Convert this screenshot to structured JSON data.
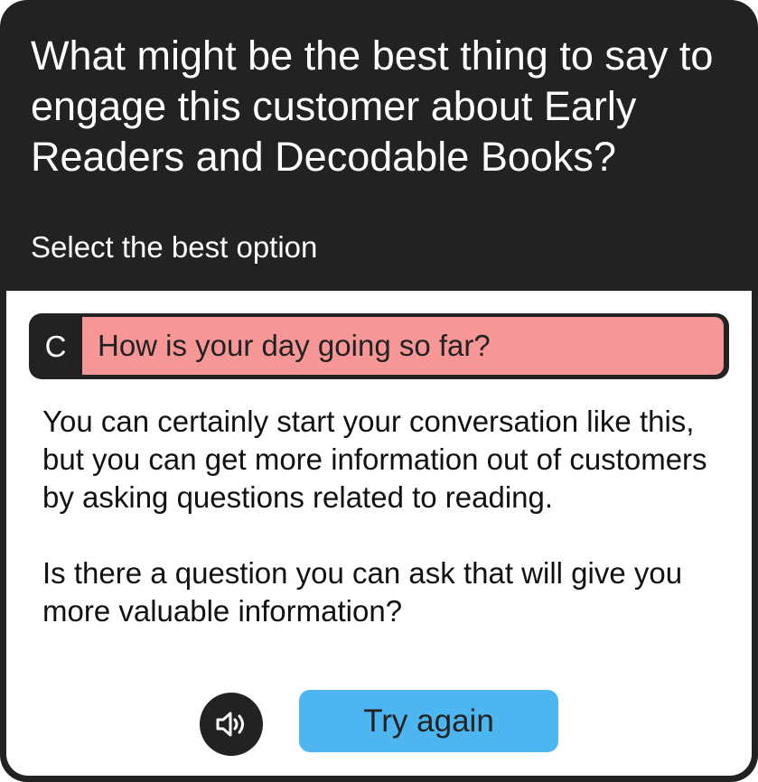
{
  "header": {
    "question": "What might be the best thing to say to engage this customer about Early Readers and Decodable Books?",
    "instruction": "Select the best option"
  },
  "selected_option": {
    "letter": "C",
    "text": "How is your day going so far?",
    "status_color": "#f79696"
  },
  "feedback": {
    "paragraph_1": "You can certainly start your conversation like this, but you can get more information out of customers by asking questions related to reading.",
    "paragraph_2": "Is there a question you can ask that will give you more valuable information?"
  },
  "actions": {
    "audio_icon": "speaker-icon",
    "try_again_label": "Try again",
    "accent_color": "#4db6f0"
  }
}
